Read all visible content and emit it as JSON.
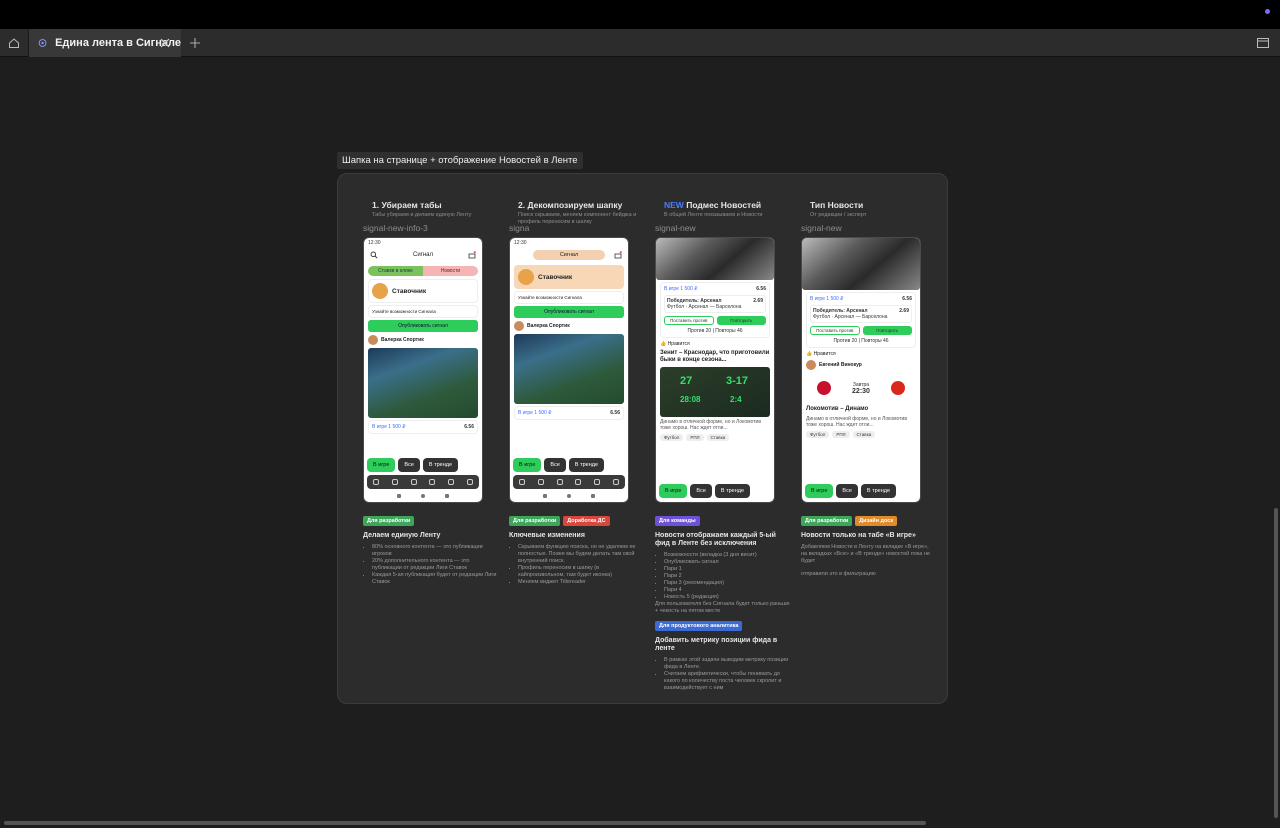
{
  "tab": {
    "title": "Едина лента в Сигнале"
  },
  "frame": {
    "title": "Шапка на странице + отображение Новостей в Ленте"
  },
  "columns": [
    {
      "header": "1. Убираем табы",
      "sub": "Табы убираем и делаем единую Ленту",
      "layer": "signal-new-info-3",
      "phone": {
        "time": "12:30",
        "app": "Сигнал",
        "tab1": "Ставки в клике",
        "tab2": "Новости",
        "profile": "Ставочник",
        "promo": "Узнайте возможности Сигнала",
        "cta": "Опубликовать сигнал",
        "author": "Валерка Спортик",
        "odds_label": "В игре 1 500 ₽",
        "odds_val": "6.56",
        "odds_val2": "2.69",
        "chips": [
          "В игре",
          "Все",
          "В тренде"
        ]
      },
      "tags": [
        {
          "label": "Для разработки",
          "color": "#3ea65a"
        }
      ],
      "note_h": "Делаем единую Ленту",
      "note_items": [
        "80% основного контента — это публикации игроков",
        "20% дополнительного контента — это публикации от редакции Лиги Ставок",
        "Каждая 5-ая публикация будет от редакции Лиги Ставок"
      ]
    },
    {
      "header": "2. Декомпозируем шапку",
      "sub": "Поиск скрываем, меняем компонент бейджа и профиль переносим в шапку",
      "layer": "signa",
      "phone": {
        "time": "12:30",
        "app": "Сигнал",
        "profile": "Ставочник",
        "promo": "Узнайте возможности Сигнала",
        "cta": "Опубликовать сигнал",
        "author": "Валерка Спортик",
        "odds_label": "В игре 1 500 ₽",
        "odds_val": "6.56",
        "chips": [
          "В игре",
          "Все",
          "В тренде"
        ]
      },
      "tags": [
        {
          "label": "Для разработки",
          "color": "#3ea65a"
        },
        {
          "label": "Доработка ДС",
          "color": "#d9463c"
        }
      ],
      "note_h": "Ключевые изменения",
      "note_items": [
        "Скрываем функцию поиска, но не удаляем ее полностью. Позже мы будем делать там свой внутренний поиск.",
        "Профиль переносим в шапку (в хайпроизвольном, там будет иконка)",
        "Меняем виджет Titlereader"
      ]
    },
    {
      "header_new": "NEW",
      "header": "Подмес Новостей",
      "sub": "В общей Ленте показываем и Новости",
      "layer": "signal-new",
      "phone": {
        "odds_label": "В игре 1 500 ₽",
        "odds_val": "6.56",
        "match": "Победитель: Арсенал",
        "match_val": "2.69",
        "teams": "Футбол · Арсенал — Барселона",
        "btn1": "Поставить против",
        "btn2": "Повторить",
        "stats": "Против 20 | Повторы 46",
        "like": "Нравится",
        "news_title": "Зенит – Краснодар, что приготовили быки в конце сезона...",
        "s1": "27",
        "s2": "3-17",
        "s3": "28:08",
        "s4": "2:4",
        "news_text": "Динамо в отличной форме, но и Локомотив тоже хорош. Нас ждет отли...",
        "tags": [
          "Футбол",
          "РПЛ",
          "Ставка"
        ],
        "chips": [
          "В игре",
          "Все",
          "В тренде"
        ]
      },
      "tags": [
        {
          "label": "Для команды",
          "color": "#6e52d6"
        }
      ],
      "note_h": "Новости отображаем каждый 5-ый фид в Ленте без исключения",
      "note_items": [
        "Возможности (вкладка (3 дня висит)",
        "Опубликовать сигнал",
        "Пари 1",
        "Пари 2",
        "Пари 3 (рекомендация)",
        "Пари 4",
        "Новость 5 (редакция)"
      ],
      "note_extra": "Для пользователя без Сигнала будет только раньше + чекость на пятом месте",
      "tags2": [
        {
          "label": "Для продуктового аналитика",
          "color": "#3d6bd6"
        }
      ],
      "note2_h": "Добавить метрику позиции фида в ленте",
      "note2_items": [
        "В рамках этой задачи выводим метрику позиции фида в Ленте.",
        "Считаем арифметически, чтобы понимать до какого по количеству поста человек скролит и взаимодействует с ним"
      ]
    },
    {
      "header": "Тип Новости",
      "sub": "От редакции / эксперт",
      "layer": "signal-new",
      "phone": {
        "odds_label": "В игре 1 500 ₽",
        "odds_val": "6.56",
        "match": "Победитель: Арсенал",
        "match_val": "2.69",
        "teams": "Футбол · Арсенал — Барселона",
        "btn1": "Поставить против",
        "btn2": "Повторить",
        "stats": "Против 20 | Повторы 46",
        "like": "Нравится",
        "expert": "Евгений Винокур",
        "time": "22:30",
        "when": "Завтра",
        "news_title": "Локомотив – Динамо",
        "news_text": "Динамо в отличной форме, но и Локомотив тоже хорош. Нас ждет отли...",
        "tags": [
          "Футбол",
          "РПЛ",
          "Ставка"
        ],
        "chips": [
          "В игре",
          "Все",
          "В тренде"
        ]
      },
      "tags": [
        {
          "label": "Для разработки",
          "color": "#3ea65a"
        },
        {
          "label": "Дизайн доск",
          "color": "#e08a2a"
        }
      ],
      "note_h": "Новости только на табе «В игре»",
      "note_body": "Добавляем Новости в Ленту на вкладке «В игре», на вкладках «Все» и «В тренде» новостей пока не будет",
      "note_body2": "отправили это в фильтрацию"
    }
  ]
}
